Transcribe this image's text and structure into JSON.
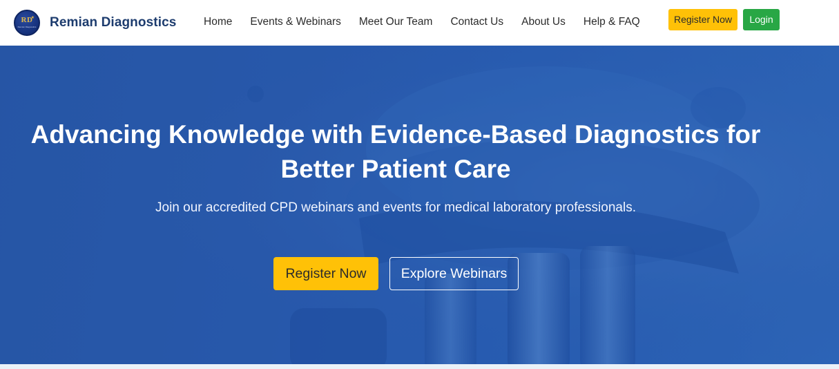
{
  "brand": {
    "logo_initials": "RD",
    "logo_subtext": "Remian Diagnostics",
    "name": "Remian Diagnostics"
  },
  "nav": {
    "links": [
      "Home",
      "Events & Webinars",
      "Meet Our Team",
      "Contact Us",
      "About Us",
      "Help & FAQ"
    ],
    "register_label": "Register Now",
    "login_label": "Login"
  },
  "hero": {
    "title": "Advancing Knowledge with Evidence-Based Diagnostics for Better Patient Care",
    "subtitle": "Join our accredited CPD webinars and events for medical laboratory professionals.",
    "primary_cta": "Register Now",
    "secondary_cta": "Explore Webinars"
  },
  "colors": {
    "brand_navy": "#1d3c6e",
    "accent_yellow": "#ffc107",
    "login_green": "#28a745",
    "hero_blue": "#2c5eb0"
  }
}
